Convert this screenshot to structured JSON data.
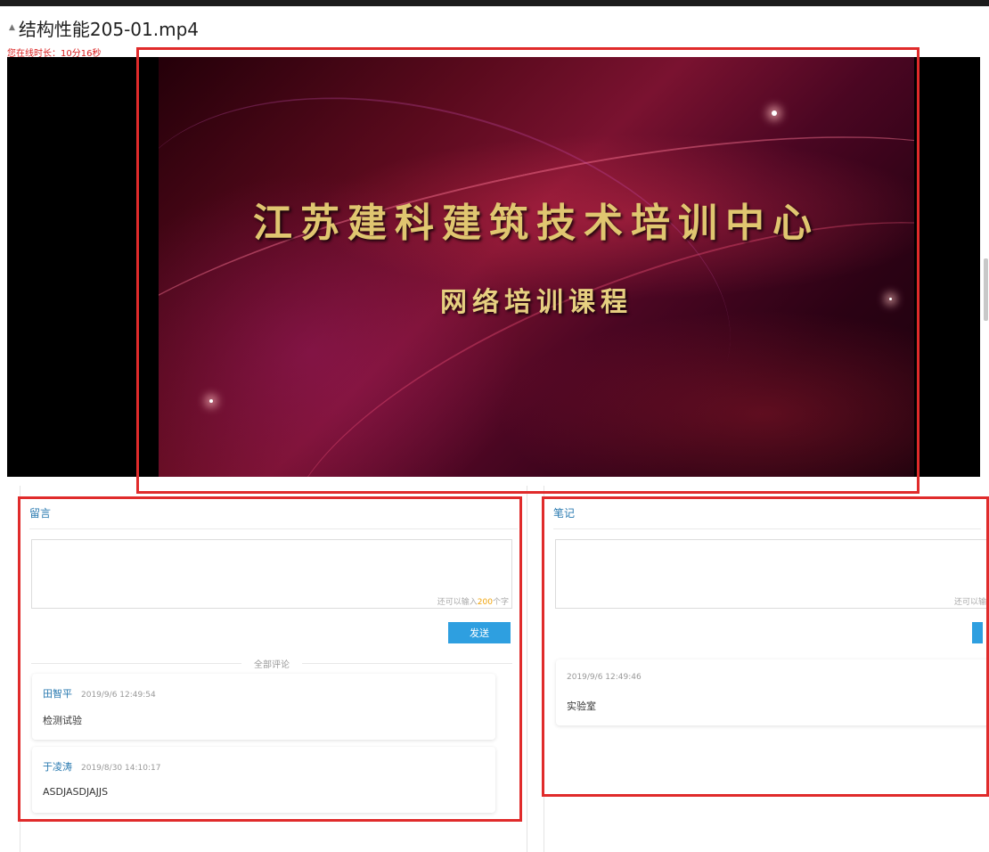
{
  "header": {
    "title": "结构性能205-01.mp4",
    "online_time": "您在线时长：10分16秒"
  },
  "video": {
    "title_line1": "江苏建科建筑技术培训中心",
    "title_line2": "网络培训课程"
  },
  "comments_panel": {
    "title": "留言",
    "counter_prefix": "还可以输入",
    "counter_num": "200",
    "counter_suffix": "个字",
    "send_label": "发送",
    "divider_label": "全部评论",
    "items": [
      {
        "author": "田智平",
        "time": "2019/9/6 12:49:54",
        "content": "检测试验"
      },
      {
        "author": "于凌涛",
        "time": "2019/8/30 14:10:17",
        "content": "ASDJASDJAJJS"
      }
    ]
  },
  "notes_panel": {
    "title": "笔记",
    "counter_prefix": "还可以输",
    "items": [
      {
        "time": "2019/9/6 12:49:46",
        "content": "实验室"
      }
    ]
  },
  "colors": {
    "highlight": "#e02b2b",
    "accent": "#2e9fe0",
    "link": "#2a7ab0",
    "counter_num": "#f0a30a"
  }
}
